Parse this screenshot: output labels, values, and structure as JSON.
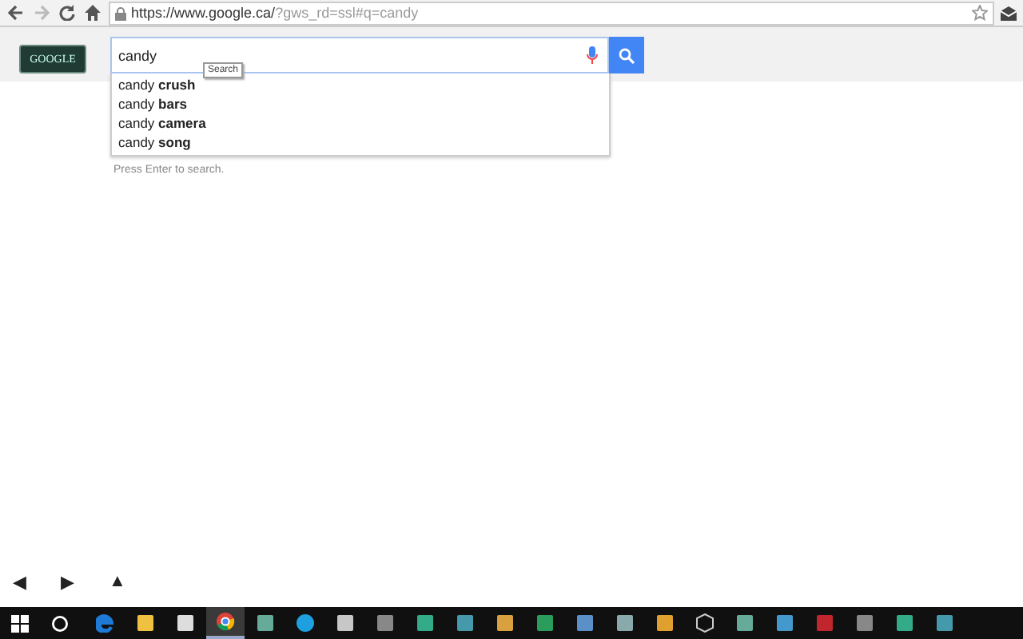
{
  "browser": {
    "url_host": "https://www.google.ca/",
    "url_rest": "?gws_rd=ssl#q=candy",
    "bookmarked": false
  },
  "logo": {
    "text": "GOOGLE"
  },
  "search": {
    "value": "candy",
    "tooltip": "Search"
  },
  "suggestions": [
    {
      "text": "candy **crush**"
    },
    {
      "text": "candy **bars**"
    },
    {
      "text": "candy **camera**"
    },
    {
      "text": "candy **song**"
    }
  ],
  "hint": "Press Enter to search.",
  "nav": [
    "◀",
    "▶",
    "▲"
  ],
  "taskbar": [
    {
      "kind": "edge",
      "selected": false
    },
    {
      "kind": "folder",
      "selected": false
    },
    {
      "kind": "store",
      "selected": false
    },
    {
      "kind": "chrome",
      "selected": true
    },
    {
      "kind": "app",
      "selected": false
    },
    {
      "kind": "skype",
      "selected": false
    },
    {
      "kind": "app",
      "selected": false
    },
    {
      "kind": "app",
      "selected": false
    },
    {
      "kind": "app",
      "selected": false
    },
    {
      "kind": "app",
      "selected": false
    },
    {
      "kind": "app",
      "selected": false
    },
    {
      "kind": "app",
      "selected": false
    },
    {
      "kind": "app",
      "selected": false
    },
    {
      "kind": "app",
      "selected": false
    },
    {
      "kind": "app",
      "selected": false
    },
    {
      "kind": "cube",
      "selected": false
    },
    {
      "kind": "app",
      "selected": false
    },
    {
      "kind": "app",
      "selected": false
    },
    {
      "kind": "filezilla",
      "selected": false
    },
    {
      "kind": "app",
      "selected": false
    },
    {
      "kind": "app",
      "selected": false
    },
    {
      "kind": "app",
      "selected": false
    }
  ]
}
